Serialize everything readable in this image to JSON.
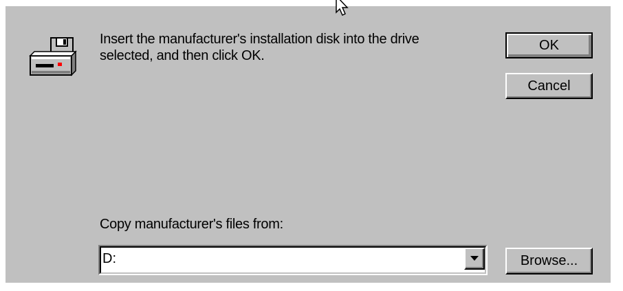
{
  "dialog": {
    "message_line1": "Insert the manufacturer's installation disk into the drive",
    "message_line2": "selected, and then click OK.",
    "copy_label": "Copy manufacturer's files from:",
    "path_value": "D:",
    "ok_label": "OK",
    "cancel_label": "Cancel",
    "browse_label": "Browse...",
    "icon": "floppy-drive-icon"
  },
  "colors": {
    "dialog_face": "#c0c0c0",
    "text": "#000000",
    "input_bg": "#ffffff",
    "accent_led": "#ff0000"
  }
}
